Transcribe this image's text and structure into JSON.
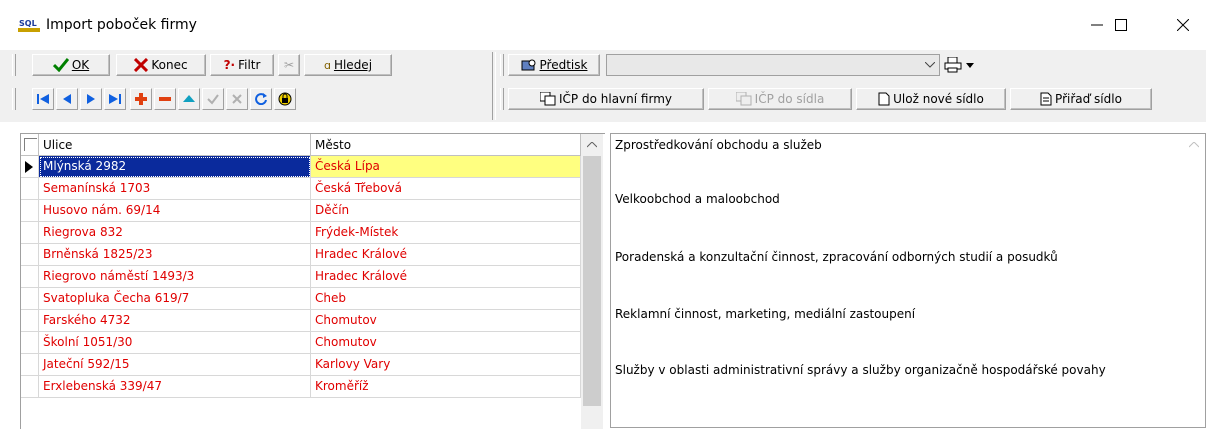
{
  "window": {
    "title": "Import poboček firmy",
    "app_icon_label": "SQL"
  },
  "toolbar": {
    "ok_label": "OK",
    "konec_label": "Konec",
    "filtr_label": "Filtr",
    "hledej_label": "Hledej",
    "predtisk_label": "Předtisk",
    "combo_value": "",
    "icp_hlavni_label": "IČP do hlavní firmy",
    "icp_sidla_label": "IČP do sídla",
    "uloz_label": "Ulož nové sídlo",
    "prirad_label": "Přiřaď sídlo"
  },
  "grid": {
    "columns": [
      "Ulice",
      "Město"
    ],
    "rows": [
      [
        "Mlýnská 2982",
        "Česká Lípa"
      ],
      [
        "Semanínská 1703",
        "Česká Třebová"
      ],
      [
        "Husovo nám. 69/14",
        "Děčín"
      ],
      [
        "Riegrova 832",
        "Frýdek-Místek"
      ],
      [
        "Brněnská 1825/23",
        "Hradec Králové"
      ],
      [
        "Riegrovo náměstí 1493/3",
        "Hradec Králové"
      ],
      [
        "Svatopluka Čecha 619/7",
        "Cheb"
      ],
      [
        "Farského 4732",
        "Chomutov"
      ],
      [
        "Školní 1051/30",
        "Chomutov"
      ],
      [
        "Jateční 592/15",
        "Karlovy Vary"
      ],
      [
        "Erxlebenská 339/47",
        "Kroměříž"
      ]
    ],
    "selected_row": 0
  },
  "memo": {
    "lines": [
      "Zprostředkování obchodu a služeb",
      "Velkoobchod a maloobchod",
      "Poradenská a konzultační činnost, zpracování odborných studií a posudků",
      "Reklamní činnost, marketing, mediální zastoupení",
      "Služby v oblasti administrativní správy a služby organizačně hospodářské povahy"
    ]
  },
  "colors": {
    "selected_bg": "#0a2a9c",
    "highlight_cell": "#ffff80",
    "row_text": "#e00000"
  }
}
